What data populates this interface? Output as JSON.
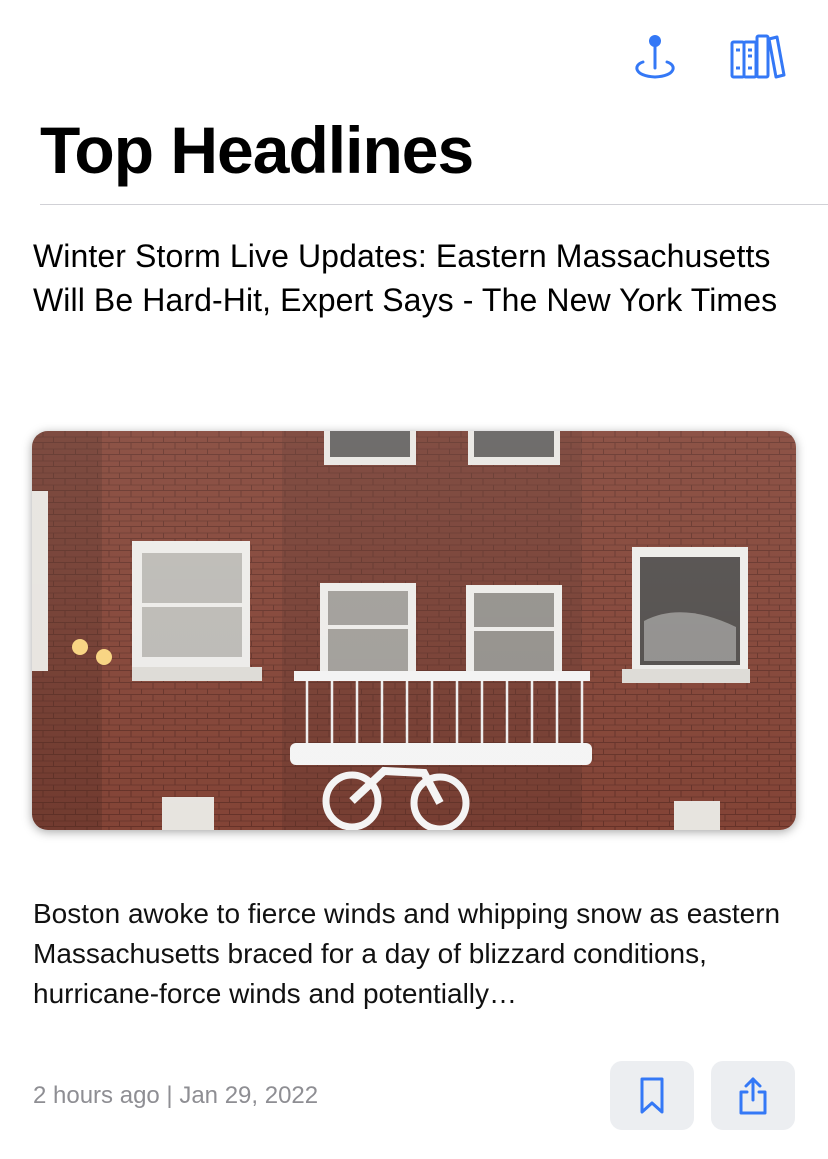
{
  "header": {
    "title": "Top Headlines",
    "icons": [
      "location-pin-icon",
      "library-books-icon"
    ],
    "accent_color": "#3478f6"
  },
  "article": {
    "headline": "Winter Storm Live Updates: Eastern Massachusetts Will Be Hard-Hit, Expert Says - The New York Times",
    "summary": "Boston awoke to fierce winds and whipping snow as eastern Massachusetts braced for a day of blizzard conditions, hurricane-force winds and potentially…",
    "meta": "2 hours ago | Jan 29, 2022",
    "actions": [
      "bookmark-icon",
      "share-icon"
    ]
  }
}
